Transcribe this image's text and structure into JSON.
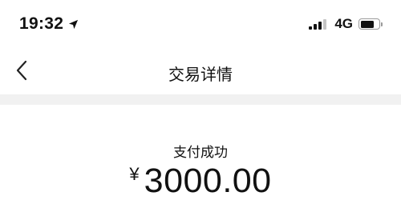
{
  "status_bar": {
    "time": "19:32",
    "location_icon": "location-arrow-icon",
    "network": "4G",
    "signal_icon": "cellular-signal-icon",
    "battery_icon": "battery-icon",
    "battery_level": 0.75
  },
  "nav": {
    "title": "交易详情",
    "back_icon": "chevron-left-icon"
  },
  "transaction": {
    "status": "支付成功",
    "currency_symbol": "¥",
    "amount": "3000.00"
  }
}
